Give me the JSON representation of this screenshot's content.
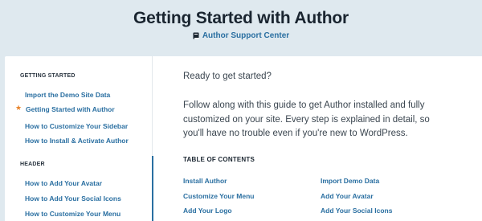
{
  "header": {
    "title": "Getting Started with Author",
    "support_link": "Author Support Center",
    "support_icon": "book-icon"
  },
  "sidebar": {
    "sections": [
      {
        "label": "GETTING STARTED",
        "items": [
          {
            "label": "Import the Demo Site Data",
            "current": false
          },
          {
            "label": "Getting Started with Author",
            "current": true
          },
          {
            "label": "How to Customize Your Sidebar",
            "current": false
          },
          {
            "label": "How to Install & Activate Author",
            "current": false
          }
        ]
      },
      {
        "label": "HEADER",
        "items": [
          {
            "label": "How to Add Your Avatar",
            "current": false
          },
          {
            "label": "How to Add Your Social Icons",
            "current": false
          },
          {
            "label": "How to Customize Your Menu",
            "current": false
          }
        ]
      }
    ],
    "current_marker_icon": "star-icon"
  },
  "main": {
    "intro": "Ready to get started?",
    "body": "Follow along with this guide to get Author installed and fully customized on your site. Every step is explained in detail, so you'll have no trouble even if you're new to WordPress.",
    "toc_title": "TABLE OF CONTENTS",
    "toc": [
      "Install Author",
      "Import Demo Data",
      "Customize Your Menu",
      "Add Your Avatar",
      "Add Your Logo",
      "Add Your Social Icons"
    ]
  },
  "colors": {
    "background": "#dfe9ef",
    "link": "#2a6fa1",
    "accent_star": "#e8842c",
    "heading": "#1a2530"
  }
}
